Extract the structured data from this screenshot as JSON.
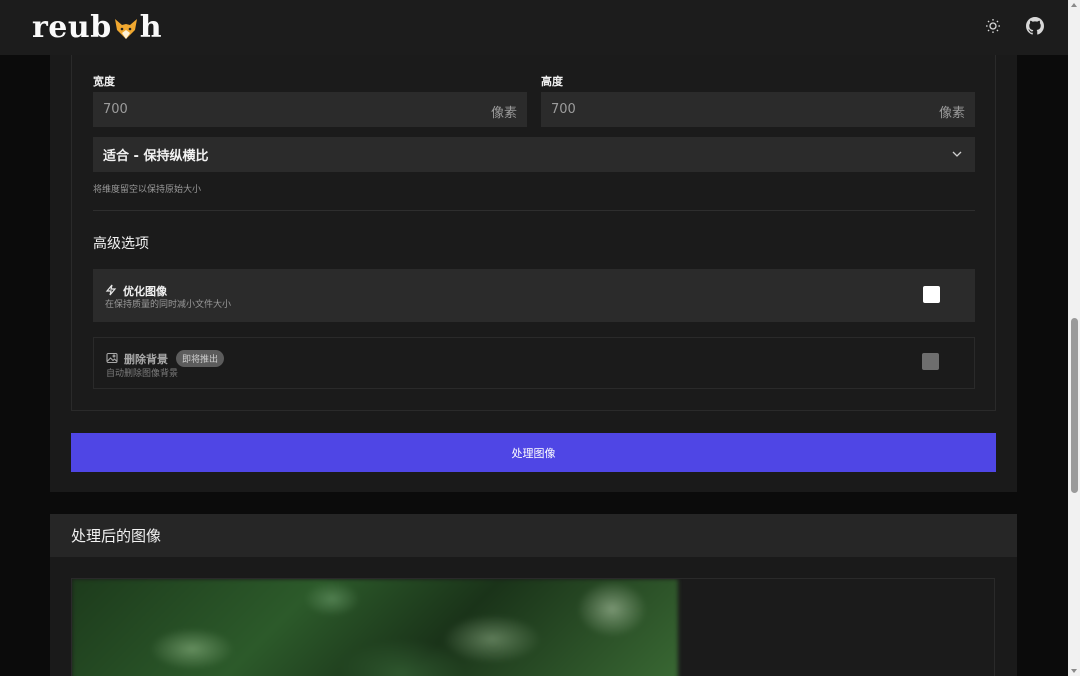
{
  "header": {
    "logo_text_left": "reub",
    "logo_text_right": "h",
    "theme_icon": "sun-icon",
    "repo_icon": "github-icon"
  },
  "dimensions": {
    "width_label": "宽度",
    "width_value": "700",
    "width_unit": "像素",
    "height_label": "高度",
    "height_value": "700",
    "height_unit": "像素",
    "fit_mode": "适合 - 保持纵横比",
    "hint": "将维度留空以保持原始大小"
  },
  "advanced": {
    "title": "高级选项",
    "options": [
      {
        "icon": "zap-icon",
        "title": "优化图像",
        "description": "在保持质量的同时减小文件大小",
        "checked": false,
        "enabled": true
      },
      {
        "icon": "image-icon",
        "title": "删除背景",
        "badge": "即将推出",
        "description": "自动删除图像背景",
        "checked": false,
        "enabled": false
      }
    ]
  },
  "actions": {
    "process_label": "处理图像"
  },
  "result": {
    "title": "处理后的图像"
  },
  "colors": {
    "accent": "#4f46e5",
    "background": "#0b0b0b",
    "card": "#1a1a1a",
    "input": "#2b2b2b"
  }
}
